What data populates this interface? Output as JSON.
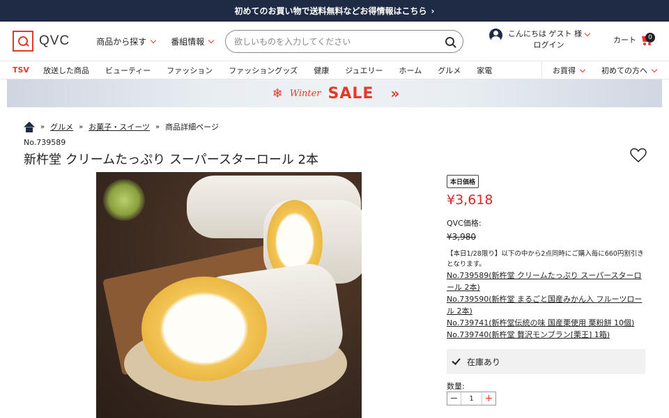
{
  "promo": {
    "text": "初めてのお買い物で送料無料などお得情報はこちら",
    "arrow": "›"
  },
  "header": {
    "logo": "QVC",
    "nav": [
      {
        "label": "商品から探す"
      },
      {
        "label": "番組情報"
      }
    ],
    "search": {
      "placeholder": "欲しいものを入力してください",
      "value": ""
    },
    "account": {
      "greeting": "こんにちは ゲスト 様",
      "login": "ログイン"
    },
    "cart": {
      "label": "カート",
      "count": "0"
    }
  },
  "categories": {
    "items": [
      "TSV",
      "放送した商品",
      "ビューティー",
      "ファッション",
      "ファッショングッズ",
      "健康",
      "ジュエリー",
      "ホーム",
      "グルメ",
      "家電"
    ],
    "right": [
      {
        "label": "お買得"
      },
      {
        "label": "初めての方へ"
      }
    ]
  },
  "banner": {
    "winter": "Winter",
    "sale": "SALE",
    "arrows": "»"
  },
  "breadcrumb": {
    "sep": "»",
    "items": [
      "グルメ",
      "お菓子・スイーツ"
    ],
    "current": "商品詳細ページ"
  },
  "product": {
    "number": "No.739589",
    "title": "新杵堂 クリームたっぷり スーパースターロール 2本",
    "price_tag": "本日価格",
    "price": "¥3,618",
    "qvc_price_label": "QVC価格:",
    "qvc_price": "¥3,980",
    "note": "【本日1/28限り】以下の中から2点同時にご購入毎に660円割引きとなります。",
    "related": [
      "No.739589(新杵堂 クリームたっぷり スーパースターロール 2本)",
      "No.739590(新杵堂 まるごと国産みかん入 フルーツロール 2本)",
      "No.739741(新杵堂伝統の味 国産栗使用 栗粉餅 10個)",
      "No.739740(新杵堂 贅沢モンブラン[栗王] 1箱)"
    ],
    "stock": "在庫あり",
    "qty_label": "数量:",
    "qty": "1"
  },
  "colors": {
    "accent": "#e4392b",
    "price": "#d8262b",
    "navy": "#1f2a44"
  }
}
